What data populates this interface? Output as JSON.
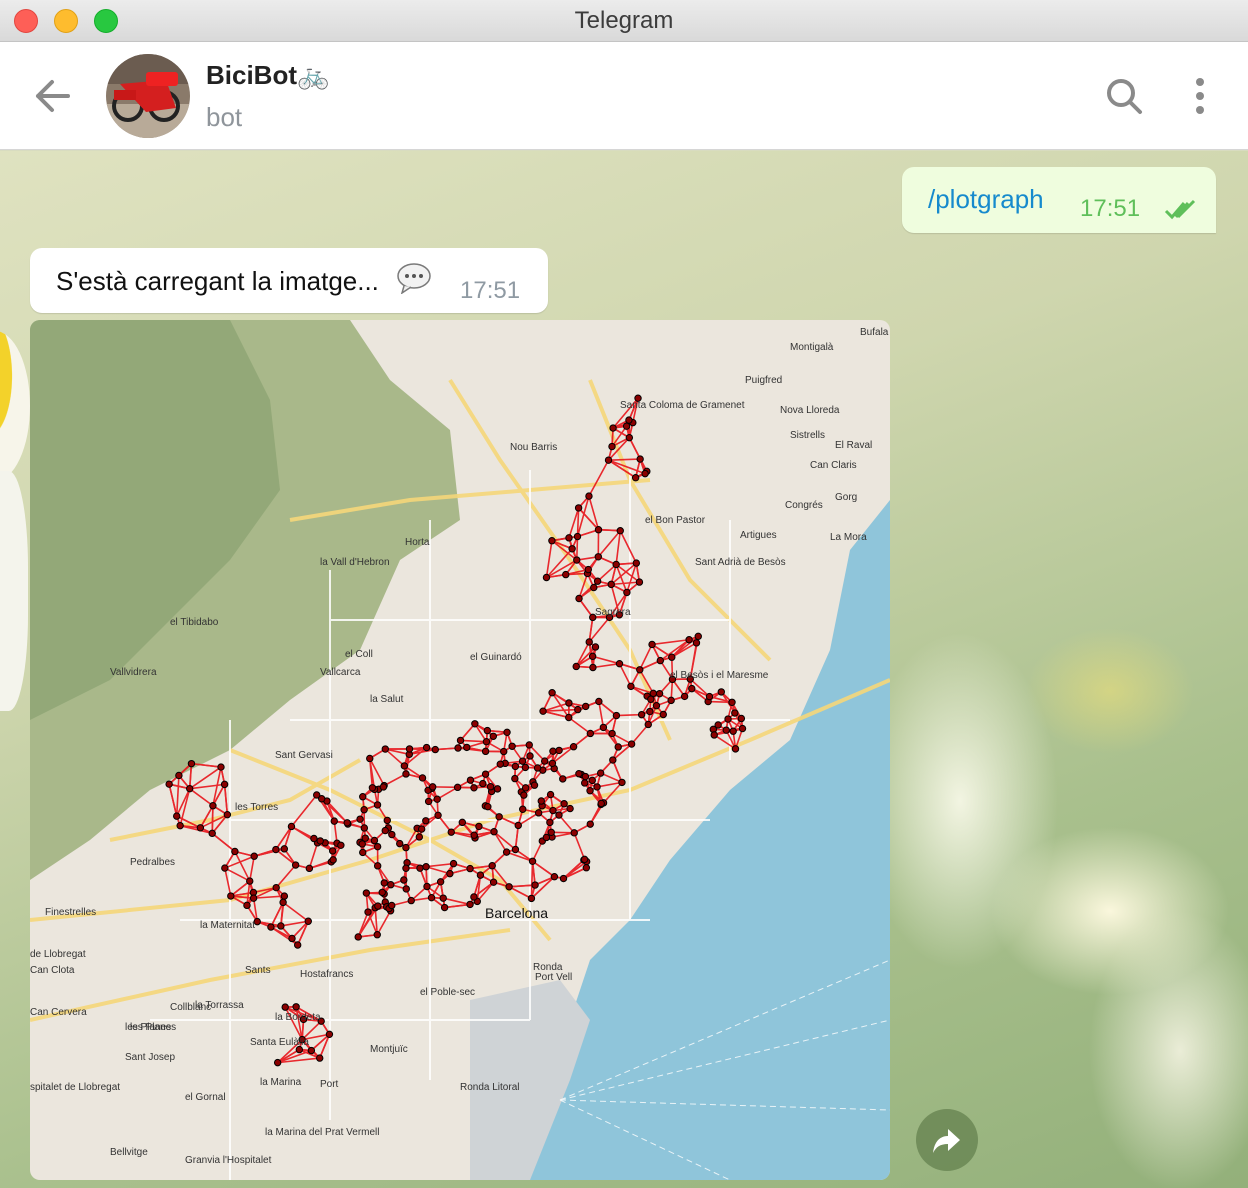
{
  "window": {
    "title": "Telegram"
  },
  "header": {
    "chat_name": "BiciBot🚲",
    "status": "bot",
    "icons": {
      "back": "arrow-left-icon",
      "search": "search-icon",
      "menu": "more-vertical-icon"
    }
  },
  "messages": [
    {
      "direction": "out",
      "text": "/plotgraph",
      "time": "17:51",
      "status_icon": "double-check-icon"
    },
    {
      "direction": "in",
      "text": "S'està carregant la imatge...",
      "emoji": "speech-balloon",
      "time": "17:51"
    },
    {
      "direction": "in",
      "type": "image",
      "description": "Map of Barcelona with red graph of bike stations"
    }
  ],
  "map": {
    "labels": [
      "Santa Coloma de Gramenet",
      "Barcelona",
      "Sant Adrià de Besòs",
      "Nou Barris",
      "Horta",
      "la Vall d'Hebron",
      "el Tibidabo",
      "Vallvidrera",
      "el Coll",
      "Vallcarca",
      "la Salut",
      "el Guinardó",
      "Sant Gervasi",
      "les Torres",
      "Pedralbes",
      "Finestrelles",
      "la Maternitat",
      "Sants",
      "de Llobregat",
      "Can Clota",
      "Can Cervera",
      "Hostafrancs",
      "el Poble-sec",
      "Port Vell",
      "la Torrassa",
      "les Planes",
      "Collblanc",
      "Sant Josep",
      "la Bordeta",
      "Santa Eulàlia",
      "Montjuïc",
      "spitalet de Llobregat",
      "el Gornal",
      "la Marina",
      "Port",
      "la Marina del Prat Vermell",
      "Bellvitge",
      "Granvia l'Hospitalet",
      "Montigalà",
      "Puigfred",
      "Nova Lloreda",
      "Sistrells",
      "El Raval",
      "Can Claris",
      "Congrés",
      "Gorg",
      "La Mora",
      "Artigues",
      "el Besòs i el Maresme",
      "el Bon Pastor",
      "Sagrera",
      "Bufala",
      "Ronda Litoral",
      "Ronda",
      "les Planes"
    ]
  },
  "colors": {
    "out_bubble": "#effdde",
    "accent": "#168acd",
    "edge": "#e8141a",
    "node": "#8b0000",
    "sea": "#8fc5da"
  }
}
